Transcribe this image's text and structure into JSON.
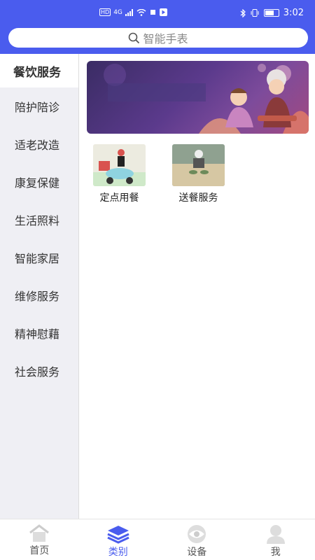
{
  "status": {
    "time": "3:02",
    "network": "HD",
    "signal": "4G"
  },
  "search": {
    "placeholder": "智能手表"
  },
  "sidebar": {
    "items": [
      {
        "label": "餐饮服务",
        "active": true
      },
      {
        "label": "陪护陪诊"
      },
      {
        "label": "适老改造"
      },
      {
        "label": "康复保健"
      },
      {
        "label": "生活照料"
      },
      {
        "label": "智能家居"
      },
      {
        "label": "维修服务"
      },
      {
        "label": "精神慰藉"
      },
      {
        "label": "社会服务"
      }
    ]
  },
  "main": {
    "tiles": [
      {
        "label": "定点用餐"
      },
      {
        "label": "送餐服务"
      }
    ]
  },
  "tabbar": {
    "items": [
      {
        "label": "首页",
        "icon": "home-icon"
      },
      {
        "label": "类别",
        "icon": "layers-icon",
        "active": true
      },
      {
        "label": "设备",
        "icon": "eye-icon"
      },
      {
        "label": "我",
        "icon": "person-icon"
      }
    ]
  },
  "colors": {
    "accent": "#4a5cee",
    "sidebar_bg": "#efeff4"
  }
}
